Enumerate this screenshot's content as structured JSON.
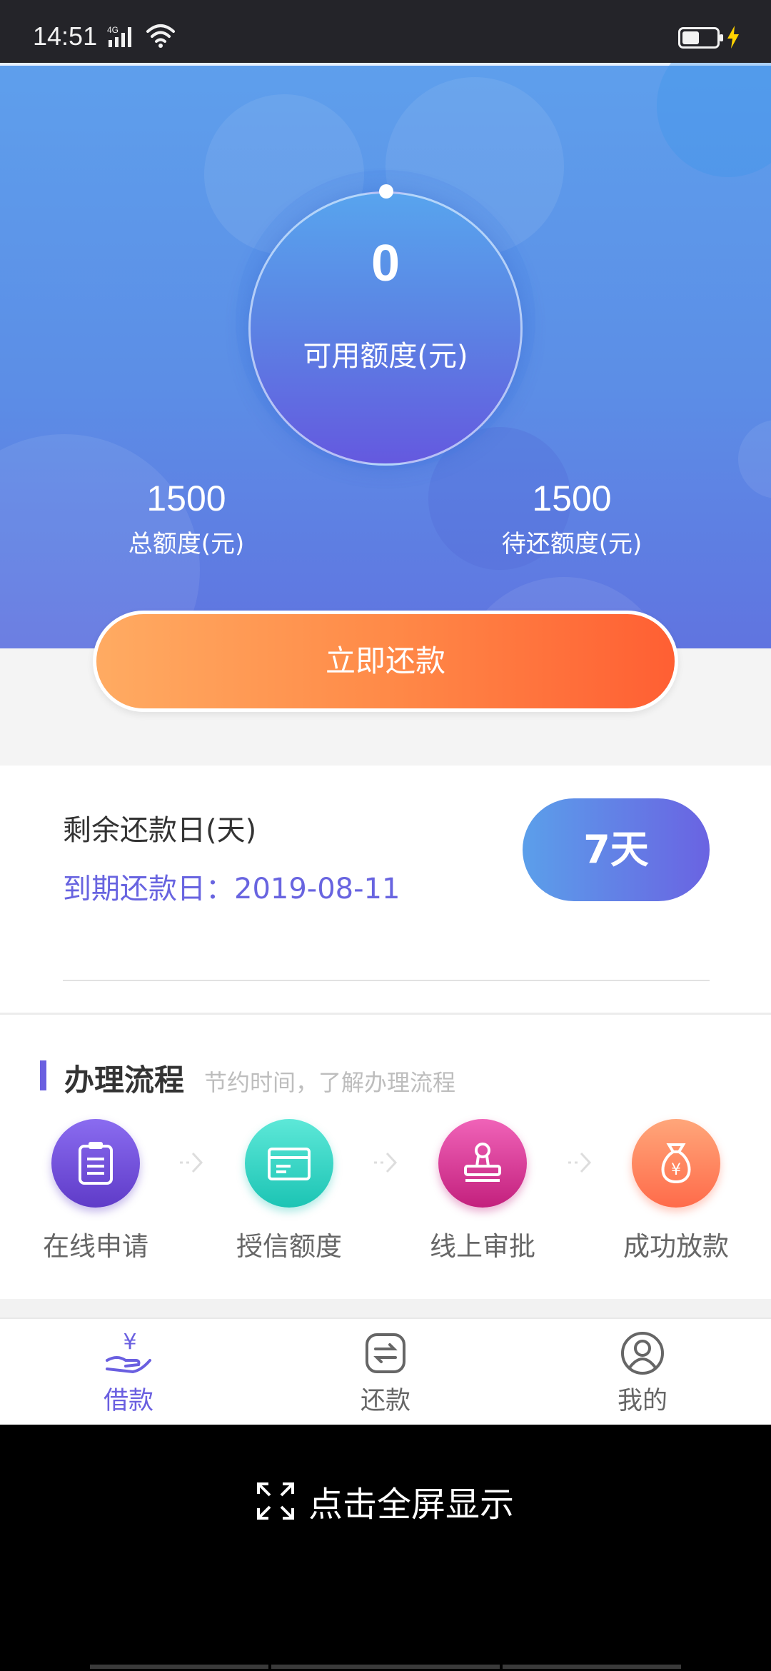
{
  "status_bar": {
    "time": "14:51",
    "network": "4G",
    "battery_level": 0.5
  },
  "hero": {
    "available_value": "0",
    "available_label": "可用额度(元)",
    "total_value": "1500",
    "total_label": "总额度(元)",
    "pending_value": "1500",
    "pending_label": "待还额度(元)"
  },
  "repay_button": {
    "label": "立即还款"
  },
  "due": {
    "title": "剩余还款日(天)",
    "date_text": "到期还款日：2019-08-11",
    "days": "7天"
  },
  "process": {
    "title": "办理流程",
    "subtitle": "节约时间，了解办理流程",
    "steps": [
      {
        "label": "在线申请",
        "icon": "clipboard-icon"
      },
      {
        "label": "授信额度",
        "icon": "card-icon"
      },
      {
        "label": "线上审批",
        "icon": "stamp-icon"
      },
      {
        "label": "成功放款",
        "icon": "money-bag-icon"
      }
    ]
  },
  "tabs": [
    {
      "label": "借款",
      "icon": "yen-hand-icon",
      "active": true
    },
    {
      "label": "还款",
      "icon": "exchange-icon",
      "active": false
    },
    {
      "label": "我的",
      "icon": "user-icon",
      "active": false
    }
  ],
  "fullscreen": {
    "label": "点击全屏显示",
    "icon": "expand-icon"
  },
  "colors": {
    "accent": "#6a5fe0",
    "orange": "#ff7a3d",
    "hero_top": "#5e9fec",
    "inactive": "#666666"
  }
}
